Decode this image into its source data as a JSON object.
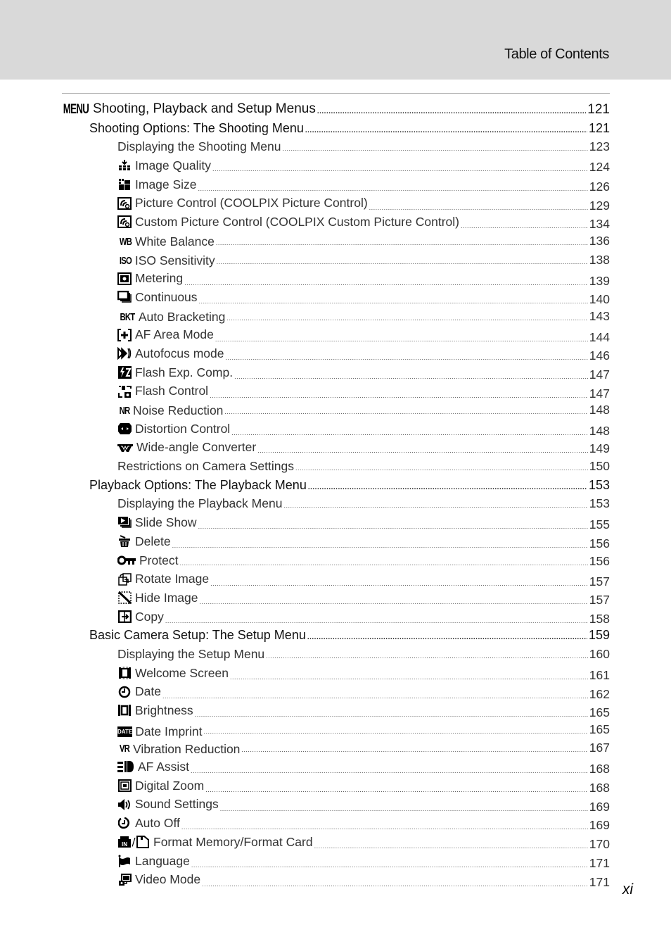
{
  "header": {
    "title": "Table of Contents"
  },
  "folio": "xi",
  "toc": {
    "chapter": {
      "icon": "MENU",
      "label": "Shooting, Playback and Setup Menus",
      "page": "121"
    },
    "sections": [
      {
        "label": "Shooting Options: The Shooting Menu",
        "page": "121",
        "items": [
          {
            "icon": "",
            "label": "Displaying the Shooting Menu",
            "page": "123"
          },
          {
            "icon": "image-quality-icon",
            "label": "Image Quality",
            "page": "124"
          },
          {
            "icon": "image-size-icon",
            "label": "Image Size",
            "page": "126"
          },
          {
            "icon": "picture-control-icon",
            "label": "Picture Control (COOLPIX Picture Control)",
            "page": "129"
          },
          {
            "icon": "custom-picture-control-icon",
            "label": "Custom Picture Control (COOLPIX Custom Picture Control)",
            "page": "134"
          },
          {
            "icon": "white-balance-icon",
            "label": "White Balance",
            "page": "136"
          },
          {
            "icon": "iso-icon",
            "label": "ISO Sensitivity",
            "page": "138"
          },
          {
            "icon": "metering-icon",
            "label": "Metering",
            "page": "139"
          },
          {
            "icon": "continuous-icon",
            "label": "Continuous",
            "page": "140"
          },
          {
            "icon": "bracketing-icon",
            "label": "Auto Bracketing",
            "page": "143"
          },
          {
            "icon": "af-area-icon",
            "label": "AF Area Mode",
            "page": "144"
          },
          {
            "icon": "autofocus-icon",
            "label": "Autofocus mode",
            "page": "146"
          },
          {
            "icon": "flash-comp-icon",
            "label": "Flash Exp. Comp.",
            "page": "147"
          },
          {
            "icon": "flash-control-icon",
            "label": "Flash Control",
            "page": "147"
          },
          {
            "icon": "noise-reduction-icon",
            "label": "Noise Reduction",
            "page": "148"
          },
          {
            "icon": "distortion-icon",
            "label": "Distortion Control",
            "page": "148"
          },
          {
            "icon": "wide-converter-icon",
            "label": "Wide-angle Converter",
            "page": "149"
          },
          {
            "icon": "",
            "label": "Restrictions on Camera Settings",
            "page": "150"
          }
        ]
      },
      {
        "label": "Playback Options: The Playback Menu",
        "page": "153",
        "items": [
          {
            "icon": "",
            "label": "Displaying the Playback Menu",
            "page": "153"
          },
          {
            "icon": "slide-show-icon",
            "label": "Slide Show",
            "page": "155"
          },
          {
            "icon": "delete-icon",
            "label": "Delete",
            "page": "156"
          },
          {
            "icon": "protect-icon",
            "label": "Protect",
            "page": "156"
          },
          {
            "icon": "rotate-icon",
            "label": "Rotate Image",
            "page": "157"
          },
          {
            "icon": "hide-image-icon",
            "label": "Hide Image",
            "page": "157"
          },
          {
            "icon": "copy-icon",
            "label": "Copy",
            "page": "158"
          }
        ]
      },
      {
        "label": "Basic Camera Setup: The Setup Menu",
        "page": "159",
        "items": [
          {
            "icon": "",
            "label": "Displaying the Setup Menu",
            "page": "160"
          },
          {
            "icon": "welcome-screen-icon",
            "label": "Welcome Screen",
            "page": "161"
          },
          {
            "icon": "date-icon",
            "label": "Date",
            "page": "162"
          },
          {
            "icon": "brightness-icon",
            "label": "Brightness",
            "page": "165"
          },
          {
            "icon": "date-imprint-icon",
            "label": "Date Imprint",
            "page": "165"
          },
          {
            "icon": "vr-icon",
            "label": "Vibration Reduction",
            "page": "167"
          },
          {
            "icon": "af-assist-icon",
            "label": "AF Assist",
            "page": "168"
          },
          {
            "icon": "digital-zoom-icon",
            "label": "Digital Zoom",
            "page": "168"
          },
          {
            "icon": "sound-icon",
            "label": "Sound Settings",
            "page": "169"
          },
          {
            "icon": "auto-off-icon",
            "label": "Auto Off",
            "page": "169"
          },
          {
            "icon": "format-icon",
            "label": "Format Memory/Format Card",
            "page": "170"
          },
          {
            "icon": "language-icon",
            "label": "Language",
            "page": "171"
          },
          {
            "icon": "video-mode-icon",
            "label": "Video Mode",
            "page": "171"
          }
        ]
      }
    ]
  },
  "icon_glyphs": {
    "wb": "WB",
    "iso": "ISO",
    "bkt": "BKT",
    "nr": "NR",
    "vr": "VR",
    "date": "DATE",
    "in": "IN",
    "slash": "/"
  }
}
